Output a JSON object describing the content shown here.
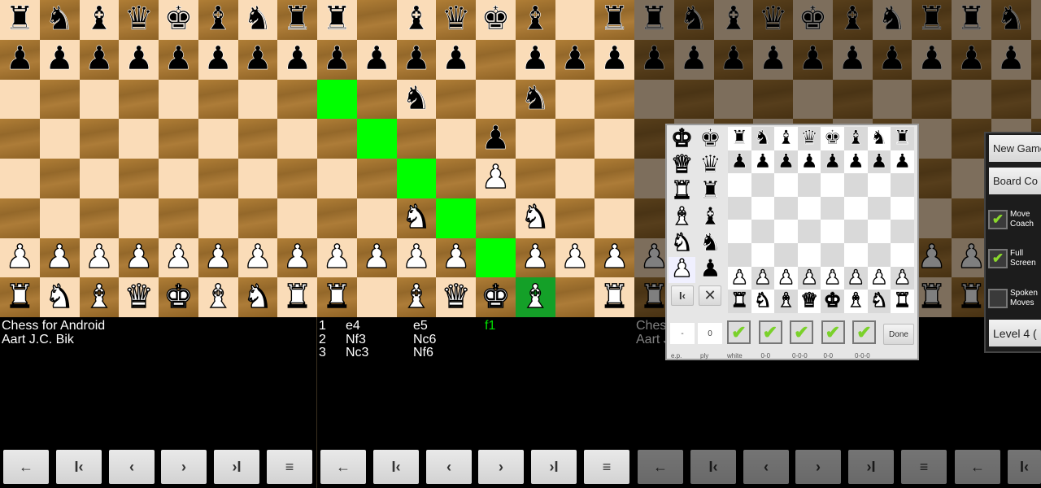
{
  "colors": {
    "highlight": "#00ff00",
    "selected": "#14a028",
    "current_move": "#00e000",
    "check": "#8ad82c"
  },
  "piece_glyphs": {
    "K": "♚",
    "Q": "♛",
    "R": "♜",
    "B": "♝",
    "N": "♞",
    "P": "♟"
  },
  "panels": [
    {
      "board": [
        "rnbqkbnr",
        "pppppppp",
        "........",
        "........",
        "........",
        "........",
        "PPPPPPPP",
        "RNBQKBNR"
      ],
      "highlights": [],
      "selected": null,
      "info": {
        "line1": "Chess for Android",
        "line2": "Aart J.C. Bik"
      }
    },
    {
      "board": [
        "r.bqkb.r",
        "pppp.ppp",
        "..n..n..",
        "....p...",
        "....P...",
        "..N..N..",
        "PPPP.PPP",
        "R.BQKB.R"
      ],
      "highlights": [
        "a6",
        "b5",
        "c4",
        "d3",
        "e2"
      ],
      "selected": "f1",
      "moves": [
        {
          "num": "1",
          "white": "e4",
          "black": "e5"
        },
        {
          "num": "2",
          "white": "Nf3",
          "black": "Nc6"
        },
        {
          "num": "3",
          "white": "Nc3",
          "black": "Nf6"
        }
      ],
      "current_move": "f1"
    },
    {
      "board": [
        "rnbqkbnr",
        "pppppppp",
        "........",
        "........",
        "........",
        "........",
        "PPPPPPPP",
        "RNBQKBNR"
      ],
      "highlights": [],
      "selected": null,
      "info": {
        "line1": "Chess for Android",
        "line2": "Aart J.C. Bik"
      }
    },
    {
      "board": [
        "rnbqkbnr",
        "pppppppp",
        "........",
        "........",
        "........",
        "........",
        "PPPPPPPP",
        "RNBQKBNR"
      ],
      "highlights": [],
      "selected": null
    }
  ],
  "nav_buttons": [
    {
      "icon": "back-arrow-icon",
      "glyph": "←"
    },
    {
      "icon": "first-move-icon",
      "glyph": "I‹"
    },
    {
      "icon": "previous-move-icon",
      "glyph": "‹"
    },
    {
      "icon": "next-move-icon",
      "glyph": "›"
    },
    {
      "icon": "last-move-icon",
      "glyph": "›I"
    },
    {
      "icon": "menu-icon",
      "glyph": "≡"
    }
  ],
  "setup_dialog": {
    "palette": [
      [
        "K",
        "k"
      ],
      [
        "Q",
        "q"
      ],
      [
        "R",
        "r"
      ],
      [
        "B",
        "b"
      ],
      [
        "N",
        "n"
      ],
      [
        "P",
        "p"
      ]
    ],
    "palette_selected": "P",
    "board": [
      "rnbqkbnr",
      "pppppppp",
      "........",
      "........",
      "........",
      "........",
      "PPPPPPPP",
      "RNBQKBNR"
    ],
    "reset_glyph": "I‹",
    "clear_glyph": "✕",
    "ep_value": "-",
    "ply_value": "0",
    "checkboxes": [
      {
        "label": "white",
        "checked": true
      },
      {
        "label": "0-0",
        "checked": true
      },
      {
        "label": "0-0-0",
        "checked": true
      },
      {
        "label": "0-0",
        "checked": true
      },
      {
        "label": "0-0-0",
        "checked": true
      }
    ],
    "ep_label": "e.p.",
    "ply_label": "ply",
    "done_label": "Done"
  },
  "menu": {
    "new_game": "New Game",
    "board_config": "Board Co",
    "move_coach": {
      "label1": "Move",
      "label2": "Coach",
      "checked": true
    },
    "full_screen": {
      "label1": "Full",
      "label2": "Screen",
      "checked": true
    },
    "spoken_moves": {
      "label1": "Spoken",
      "label2": "Moves",
      "checked": false
    },
    "level": "Level 4 ("
  }
}
